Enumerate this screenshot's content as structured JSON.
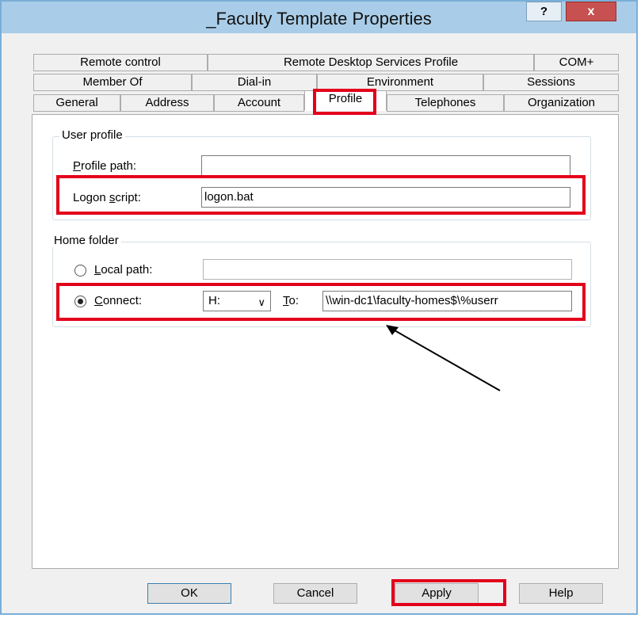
{
  "window": {
    "title": "_Faculty Template Properties"
  },
  "titlebar_buttons": {
    "help": "?",
    "close": "x"
  },
  "tabs": {
    "row1": [
      "Remote control",
      "Remote Desktop Services Profile",
      "COM+"
    ],
    "row2": [
      "Member Of",
      "Dial-in",
      "Environment",
      "Sessions"
    ],
    "row3": [
      "General",
      "Address",
      "Account",
      "Profile",
      "Telephones",
      "Organization"
    ],
    "active": "Profile"
  },
  "user_profile": {
    "legend": "User profile",
    "profile_path_label": "Profile path:",
    "profile_path_value": "",
    "logon_script_label": "Logon script:",
    "logon_script_value": "logon.bat"
  },
  "home_folder": {
    "legend": "Home folder",
    "local_path_label": "Local path:",
    "local_path_value": "",
    "connect_label": "Connect:",
    "drive": "H:",
    "to_label": "To:",
    "to_value": "\\\\win-dc1\\faculty-homes$\\%userr",
    "selected": "connect"
  },
  "buttons": {
    "ok": "OK",
    "cancel": "Cancel",
    "apply": "Apply",
    "help": "Help"
  },
  "highlight_color": "#e3001b"
}
